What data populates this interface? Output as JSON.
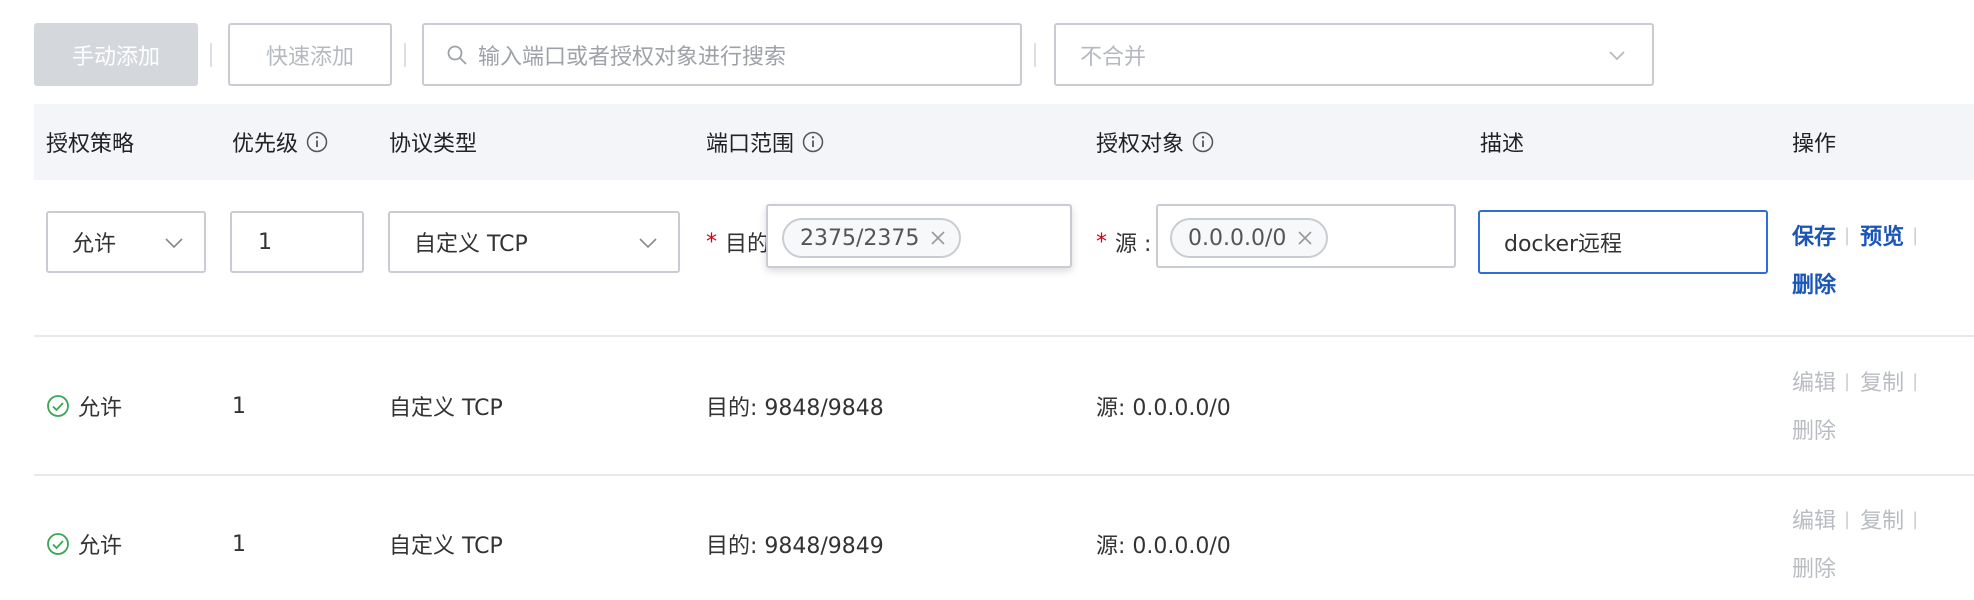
{
  "toolbar": {
    "manual_add": "手动添加",
    "quick_add": "快速添加",
    "search_placeholder": "输入端口或者授权对象进行搜索",
    "merge_select": "不合并"
  },
  "table": {
    "headers": {
      "policy": "授权策略",
      "priority": "优先级",
      "protocol": "协议类型",
      "port_range": "端口范围",
      "auth_object": "授权对象",
      "description": "描述",
      "actions": "操作"
    }
  },
  "edit_row": {
    "policy": "允许",
    "priority": "1",
    "protocol": "自定义 TCP",
    "required_mark": "*",
    "dest_label": "目的",
    "port_tag": "2375/2375",
    "source_label": "源 :",
    "source_tag": "0.0.0.0/0",
    "description": "docker远程",
    "actions": {
      "save": "保存",
      "preview": "预览",
      "delete": "删除",
      "separator": "|"
    }
  },
  "rows": [
    {
      "policy": "允许",
      "priority": "1",
      "protocol": "自定义 TCP",
      "port_range": "目的: 9848/9848",
      "auth_object": "源: 0.0.0.0/0",
      "actions": {
        "edit": "编辑",
        "copy": "复制",
        "delete": "删除"
      }
    },
    {
      "policy": "允许",
      "priority": "1",
      "protocol": "自定义 TCP",
      "port_range": "目的: 9848/9849",
      "auth_object": "源: 0.0.0.0/0",
      "actions": {
        "edit": "编辑",
        "copy": "复制",
        "delete": "删除"
      }
    }
  ],
  "colors": {
    "link": "#1a56b8",
    "focus_border": "#2d6fd6",
    "success": "#3aa556",
    "required": "#d0021b"
  },
  "icons": [
    "search-icon",
    "chevron-down-icon",
    "info-icon",
    "close-icon",
    "check-circle-icon"
  ]
}
